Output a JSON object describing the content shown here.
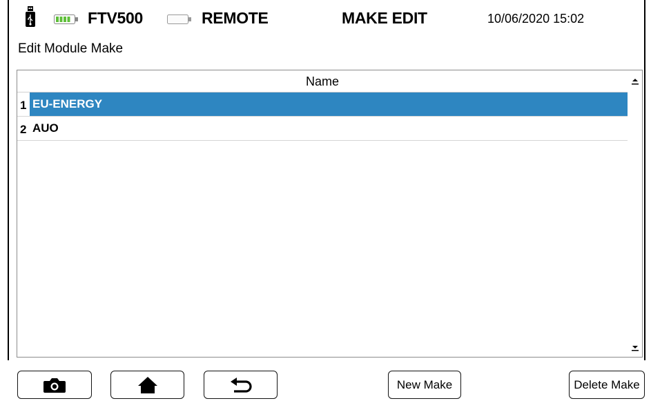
{
  "status_bar": {
    "device_name": "FTV500",
    "mode_label": "REMOTE",
    "screen_title": "MAKE EDIT",
    "datetime": "10/06/2020 15:02",
    "battery_color": "#5fbf3a",
    "icons": [
      "usb-icon",
      "battery-icon",
      "remote-battery-icon"
    ]
  },
  "page": {
    "title": "Edit Module Make"
  },
  "table": {
    "column_header": "Name",
    "rows": [
      {
        "num": "1",
        "name": "EU-ENERGY",
        "selected": true
      },
      {
        "num": "2",
        "name": "AUO",
        "selected": false
      }
    ],
    "selection_color": "#2e86c1"
  },
  "buttons": {
    "camera_icon": "camera-icon",
    "home_icon": "home-icon",
    "back_icon": "back-arrow-icon",
    "new_make": "New Make",
    "delete_make": "Delete Make"
  }
}
